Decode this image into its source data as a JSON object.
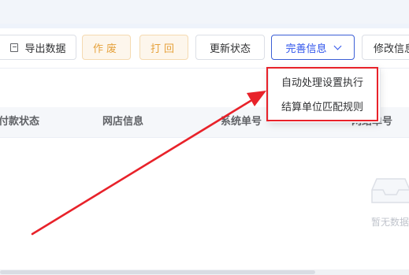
{
  "toolbar": {
    "export_label": "导出数据",
    "void_label": "作废",
    "return_label": "打回",
    "update_status_label": "更新状态",
    "complete_info_label": "完善信息",
    "modify_info_label": "修改信息"
  },
  "dropdown": {
    "items": [
      {
        "label": "自动处理设置执行"
      },
      {
        "label": "结算单位匹配规则"
      }
    ]
  },
  "table": {
    "columns": [
      "付款状态",
      "网店信息",
      "系统单号",
      "网络单号"
    ],
    "empty_text": "暂无数据"
  },
  "annotation": {
    "highlight_color": "#e8222a"
  },
  "colors": {
    "primary": "#2f54eb",
    "warning": "#e6a23c"
  }
}
